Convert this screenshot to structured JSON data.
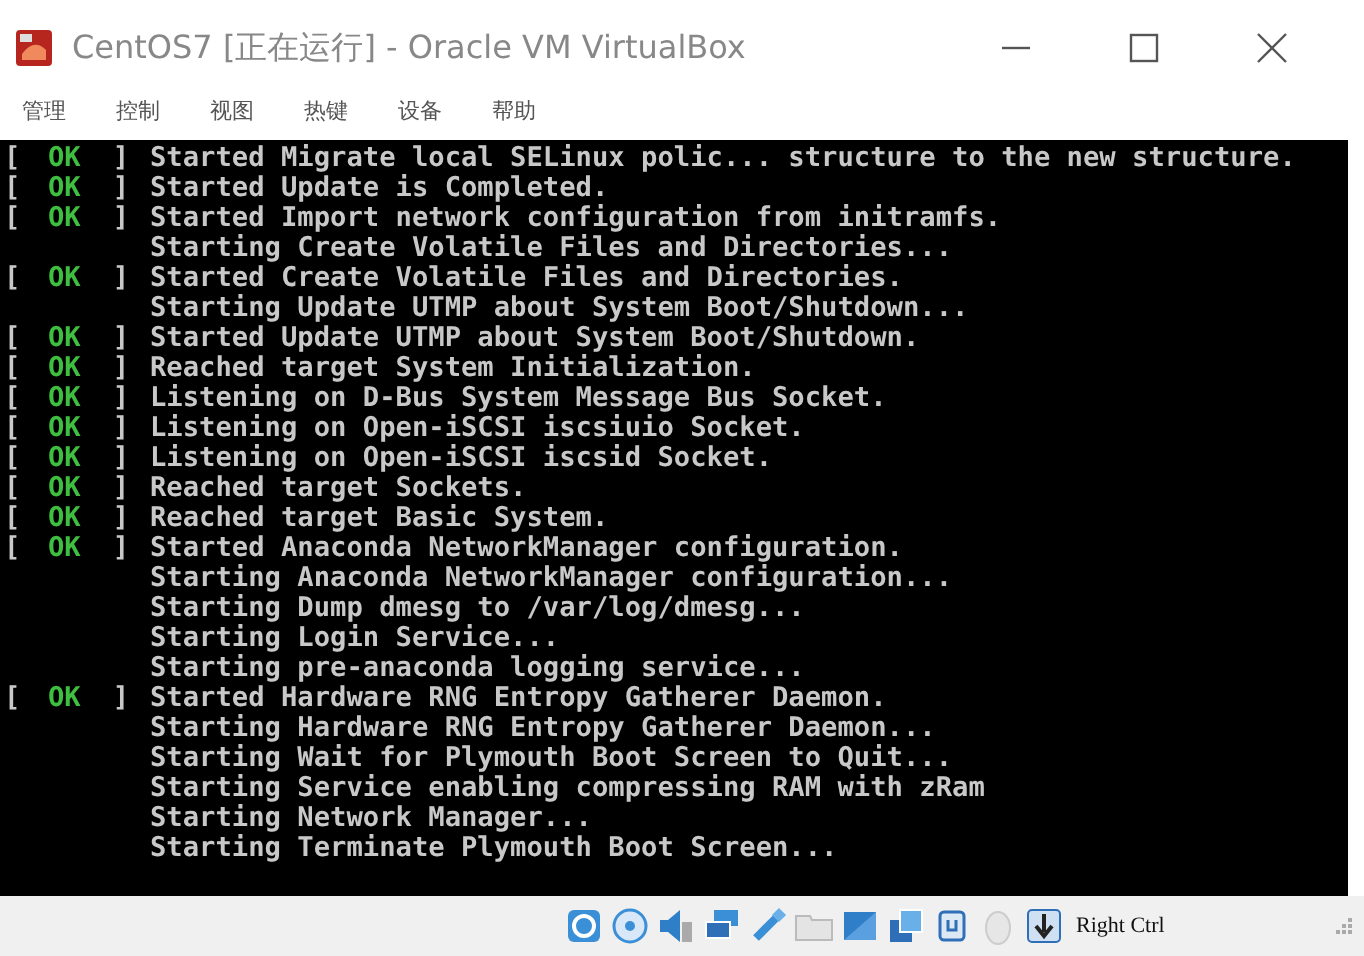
{
  "window": {
    "title": "CentOS7 [正在运行] - Oracle VM VirtualBox"
  },
  "menu": [
    "管理",
    "控制",
    "视图",
    "热键",
    "设备",
    "帮助"
  ],
  "console": [
    {
      "kind": "ok",
      "status": {
        "open": "[",
        "label": "OK",
        "close": "]"
      },
      "text": "Started Migrate local SELinux polic... structure to the new structure."
    },
    {
      "kind": "ok",
      "status": {
        "open": "[",
        "label": "OK",
        "close": "]"
      },
      "text": "Started Update is Completed."
    },
    {
      "kind": "ok",
      "status": {
        "open": "[",
        "label": "OK",
        "close": "]"
      },
      "text": "Started Import network configuration from initramfs."
    },
    {
      "kind": "plain",
      "text": "Starting Create Volatile Files and Directories..."
    },
    {
      "kind": "ok",
      "status": {
        "open": "[",
        "label": "OK",
        "close": "]"
      },
      "text": "Started Create Volatile Files and Directories."
    },
    {
      "kind": "plain",
      "text": "Starting Update UTMP about System Boot/Shutdown..."
    },
    {
      "kind": "ok",
      "status": {
        "open": "[",
        "label": "OK",
        "close": "]"
      },
      "text": "Started Update UTMP about System Boot/Shutdown."
    },
    {
      "kind": "ok",
      "status": {
        "open": "[",
        "label": "OK",
        "close": "]"
      },
      "text": "Reached target System Initialization."
    },
    {
      "kind": "ok",
      "status": {
        "open": "[",
        "label": "OK",
        "close": "]"
      },
      "text": "Listening on D-Bus System Message Bus Socket."
    },
    {
      "kind": "ok",
      "status": {
        "open": "[",
        "label": "OK",
        "close": "]"
      },
      "text": "Listening on Open-iSCSI iscsiuio Socket."
    },
    {
      "kind": "ok",
      "status": {
        "open": "[",
        "label": "OK",
        "close": "]"
      },
      "text": "Listening on Open-iSCSI iscsid Socket."
    },
    {
      "kind": "ok",
      "status": {
        "open": "[",
        "label": "OK",
        "close": "]"
      },
      "text": "Reached target Sockets."
    },
    {
      "kind": "ok",
      "status": {
        "open": "[",
        "label": "OK",
        "close": "]"
      },
      "text": "Reached target Basic System."
    },
    {
      "kind": "ok",
      "status": {
        "open": "[",
        "label": "OK",
        "close": "]"
      },
      "text": "Started Anaconda NetworkManager configuration."
    },
    {
      "kind": "plain",
      "text": "Starting Anaconda NetworkManager configuration..."
    },
    {
      "kind": "plain",
      "text": "Starting Dump dmesg to /var/log/dmesg..."
    },
    {
      "kind": "plain",
      "text": "Starting Login Service..."
    },
    {
      "kind": "plain",
      "text": "Starting pre-anaconda logging service..."
    },
    {
      "kind": "ok",
      "status": {
        "open": "[",
        "label": "OK",
        "close": "]"
      },
      "text": "Started Hardware RNG Entropy Gatherer Daemon."
    },
    {
      "kind": "plain",
      "text": "Starting Hardware RNG Entropy Gatherer Daemon..."
    },
    {
      "kind": "plain",
      "text": "Starting Wait for Plymouth Boot Screen to Quit..."
    },
    {
      "kind": "plain",
      "text": "Starting Service enabling compressing RAM with zRam"
    },
    {
      "kind": "plain",
      "text": "Starting Network Manager..."
    },
    {
      "kind": "plain",
      "text": "Starting Terminate Plymouth Boot Screen..."
    }
  ],
  "status_bar": {
    "host_key": "Right Ctrl"
  }
}
